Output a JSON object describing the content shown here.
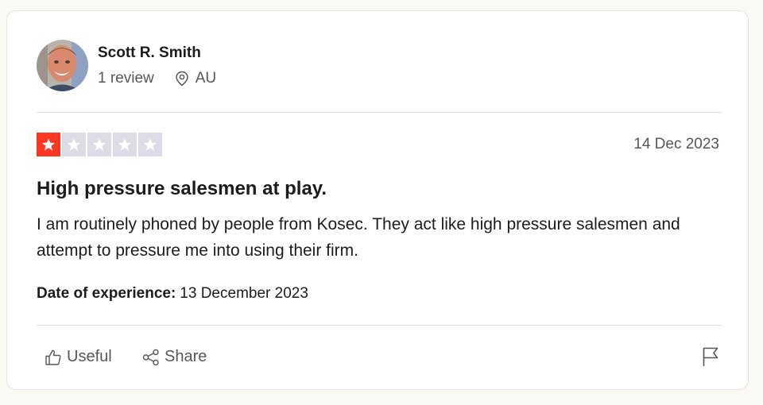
{
  "reviewer": {
    "name": "Scott R. Smith",
    "review_count": "1 review",
    "country": "AU",
    "avatar_icon": "user-photo-avatar",
    "location_icon": "location-pin-icon"
  },
  "review": {
    "rating": 1,
    "rating_max": 5,
    "star_filled_color": "#ff3722",
    "star_empty_color": "#dcdce6",
    "date": "14 Dec 2023",
    "title": "High pressure salesmen at play.",
    "text": "I am routinely phoned by people from Kosec. They act like high pressure salesmen and attempt to pressure me into using their firm.",
    "experience_label": "Date of experience:",
    "experience_date": "13 December 2023"
  },
  "actions": {
    "useful_label": "Useful",
    "share_label": "Share",
    "useful_icon": "thumbs-up-icon",
    "share_icon": "share-icon",
    "report_icon": "flag-icon"
  }
}
